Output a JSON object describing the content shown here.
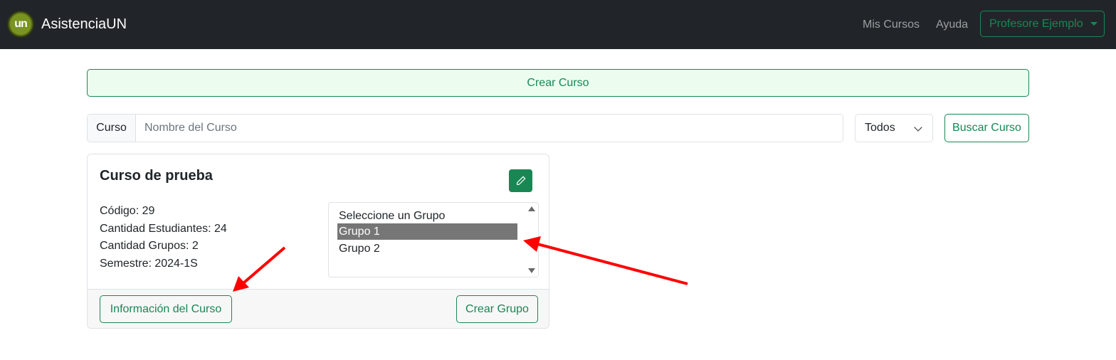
{
  "navbar": {
    "logo_text": "un",
    "brand": "AsistenciaUN",
    "links": [
      "Mis Cursos",
      "Ayuda"
    ],
    "user_menu": "Profesore Ejemplo"
  },
  "create_course_button": "Crear Curso",
  "search": {
    "prefix": "Curso",
    "placeholder": "Nombre del Curso",
    "filter_value": "Todos",
    "search_button": "Buscar Curso"
  },
  "course_card": {
    "title": "Curso de prueba",
    "codigo": "Código: 29",
    "estudiantes": "Cantidad Estudiantes: 24",
    "grupos": "Cantidad Grupos: 2",
    "semestre": "Semestre: 2024-1S",
    "group_options": [
      "Seleccione un Grupo",
      "Grupo 1",
      "Grupo 2"
    ],
    "selected_group": "Grupo 1",
    "info_button": "Información del Curso",
    "create_group_button": "Crear Grupo"
  },
  "colors": {
    "navbar_bg": "#212529",
    "accent_green": "#198754",
    "annotation_arrow": "#ff0000"
  }
}
